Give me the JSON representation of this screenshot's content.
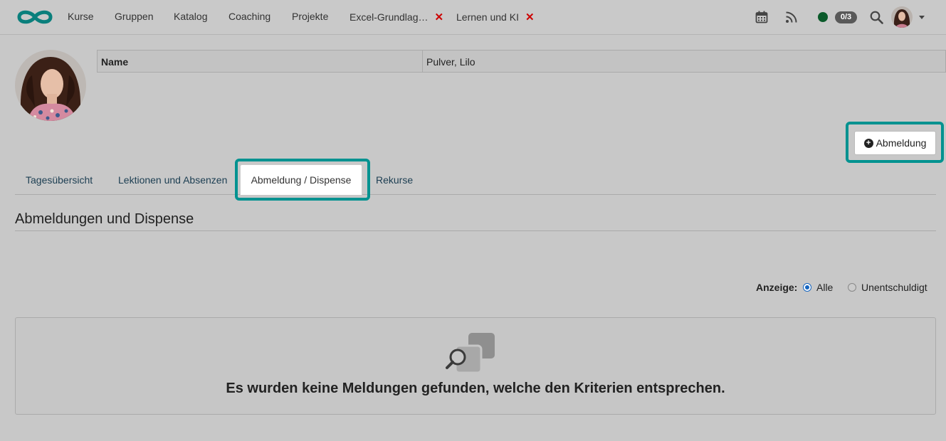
{
  "nav": {
    "items": [
      {
        "label": "Kurse"
      },
      {
        "label": "Gruppen"
      },
      {
        "label": "Katalog"
      },
      {
        "label": "Coaching"
      },
      {
        "label": "Projekte"
      },
      {
        "label": "Excel-Grundlag…",
        "closable": true
      },
      {
        "label": "Lernen und KI",
        "closable": true
      }
    ],
    "close_glyph": "✕",
    "icons": [
      "calendar-icon",
      "rss-icon",
      "search-icon"
    ],
    "status_color": "#0a5a2a",
    "badge": "0/3"
  },
  "profile": {
    "name_key": "Name",
    "name_value": "Pulver, Lilo"
  },
  "actions": {
    "add_absence_label": "Abmeldung"
  },
  "tabs": [
    {
      "label": "Tagesübersicht"
    },
    {
      "label": "Lektionen und Absenzen"
    },
    {
      "label": "Abmeldung / Dispense",
      "active": true
    },
    {
      "label": "Rekurse"
    }
  ],
  "section": {
    "title": "Abmeldungen und Dispense"
  },
  "filter": {
    "label": "Anzeige:",
    "options": [
      {
        "label": "Alle",
        "checked": true
      },
      {
        "label": "Unentschuldigt",
        "checked": false
      }
    ]
  },
  "empty": {
    "message": "Es wurden keine Meldungen gefunden, welche den Kriterien entsprechen."
  },
  "colors": {
    "highlight": "#009290",
    "accent": "#1565c0",
    "close": "#cc0000"
  }
}
